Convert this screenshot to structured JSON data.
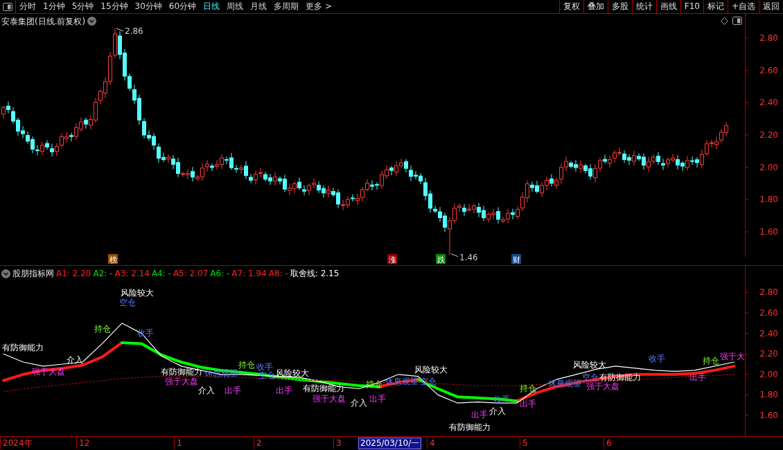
{
  "toolbar": {
    "tabs": [
      {
        "label": "分时",
        "selected": false
      },
      {
        "label": "1分钟",
        "selected": false
      },
      {
        "label": "5分钟",
        "selected": false
      },
      {
        "label": "15分钟",
        "selected": false
      },
      {
        "label": "30分钟",
        "selected": false
      },
      {
        "label": "60分钟",
        "selected": false
      },
      {
        "label": "日线",
        "selected": true
      },
      {
        "label": "周线",
        "selected": false
      },
      {
        "label": "月线",
        "selected": false
      },
      {
        "label": "多周期",
        "selected": false
      }
    ],
    "more": "更多 >",
    "buttons": [
      "复权",
      "叠加",
      "多股",
      "统计",
      "画线",
      "F10",
      "标记",
      "+自选",
      "返回"
    ]
  },
  "price_panel": {
    "title": "安泰集团(日线.前复权)",
    "high_label": "2.86",
    "low_label": "1.46",
    "markers": [
      {
        "text": "榜",
        "color": "#9c5200"
      },
      {
        "text": "涨",
        "color": "#9a0000"
      },
      {
        "text": "跌",
        "color": "#0a8a0a"
      },
      {
        "text": "财",
        "color": "#174a8c"
      }
    ],
    "axis_labels": [
      "2.80",
      "2.60",
      "2.40",
      "2.20",
      "2.00",
      "1.80",
      "1.60"
    ]
  },
  "indicator": {
    "title": "股朋指标网",
    "legend": [
      {
        "text": "A1: 2.20",
        "color": "#ff2020"
      },
      {
        "text": "A2: -",
        "color": "#00e000"
      },
      {
        "text": "A3: 2.14",
        "color": "#ff2020"
      },
      {
        "text": "A4: -",
        "color": "#00e000"
      },
      {
        "text": "A5: 2.07",
        "color": "#ff2020"
      },
      {
        "text": "A6: -",
        "color": "#00e000"
      },
      {
        "text": "A7: 1.94",
        "color": "#ff2020"
      },
      {
        "text": "A8: -",
        "color": "#ff2020"
      },
      {
        "text": "取舍线: 2.15",
        "color": "#ffffff"
      }
    ],
    "chart_data": {
      "type": "line",
      "ylim": [
        1.39,
        3.06
      ],
      "yticks": [
        {
          "value": 2.8,
          "label": "2.80"
        },
        {
          "value": 2.6,
          "label": "2.60"
        },
        {
          "value": 2.4,
          "label": "2.40"
        },
        {
          "value": 2.2,
          "label": "2.20"
        },
        {
          "value": 2.0,
          "label": "2.00"
        },
        {
          "value": 1.8,
          "label": "1.80"
        },
        {
          "value": 1.6,
          "label": "1.60"
        }
      ],
      "series": [
        {
          "color": "#ff1a1a",
          "values": [
            1.94,
            2.0,
            2.04,
            2.06,
            2.09,
            2.17,
            2.31,
            null,
            null,
            null,
            null,
            null,
            null,
            null,
            null,
            null,
            null,
            null,
            null,
            1.88,
            1.92,
            1.95,
            null,
            null,
            null,
            null,
            1.74,
            1.82,
            1.88,
            1.92,
            1.95,
            1.98,
            2.0,
            2.0,
            2.0,
            2.01,
            2.04,
            2.08
          ]
        },
        {
          "color": "#00ff00",
          "values": [
            null,
            null,
            null,
            null,
            null,
            null,
            2.31,
            2.3,
            2.19,
            2.12,
            2.07,
            2.04,
            2.02,
            2.0,
            1.97,
            1.95,
            1.93,
            1.91,
            1.89,
            1.88,
            null,
            1.95,
            1.86,
            1.78,
            1.77,
            1.76,
            1.74,
            null,
            null,
            null,
            null,
            null,
            null,
            null,
            null,
            null,
            null,
            null
          ]
        },
        {
          "color": "#ffffff",
          "values": [
            2.2,
            2.12,
            2.08,
            2.1,
            2.12,
            2.3,
            2.5,
            2.4,
            2.18,
            2.08,
            2.04,
            2.0,
            2.0,
            1.99,
            1.98,
            1.97,
            1.93,
            1.88,
            1.86,
            1.92,
            2.0,
            1.98,
            1.8,
            1.72,
            1.73,
            1.72,
            1.72,
            1.86,
            1.95,
            2.0,
            2.05,
            2.08,
            2.06,
            2.04,
            2.03,
            2.04,
            2.08,
            2.12
          ]
        },
        {
          "color": "#8a1010",
          "line_style": "dashed",
          "values": [
            1.83,
            1.86,
            1.88,
            1.9,
            1.92,
            1.94,
            1.96,
            1.97,
            1.98,
            1.98,
            1.98,
            1.97,
            1.97,
            1.96,
            1.96,
            1.95,
            1.94,
            1.94,
            1.93,
            1.92,
            1.92,
            1.92,
            1.91,
            1.9,
            1.89,
            1.89,
            1.89,
            1.9,
            1.91,
            1.92,
            1.93,
            1.94,
            1.95,
            1.96,
            1.97,
            1.98,
            1.99,
            2.0
          ]
        }
      ]
    },
    "signals": [
      {
        "text": "风险较大",
        "kind": "info"
      },
      {
        "text": "空仓",
        "kind": "rest"
      },
      {
        "text": "有防御能力",
        "kind": "info"
      },
      {
        "text": "持仓",
        "kind": "hold"
      },
      {
        "text": "收手",
        "kind": "rest"
      },
      {
        "text": "强于大盘",
        "kind": "strong"
      },
      {
        "text": "介入",
        "kind": "info"
      },
      {
        "text": "有防御能力",
        "kind": "info"
      },
      {
        "text": "强于大盘",
        "kind": "strong"
      },
      {
        "text": "介入",
        "kind": "info"
      },
      {
        "text": "出手",
        "kind": "strong"
      },
      {
        "text": "休息观望",
        "kind": "rest"
      },
      {
        "text": "持仓",
        "kind": "hold"
      },
      {
        "text": "收手",
        "kind": "rest"
      },
      {
        "text": "空仓",
        "kind": "rest"
      },
      {
        "text": "风险较大",
        "kind": "info"
      },
      {
        "text": "出手",
        "kind": "strong"
      },
      {
        "text": "有防御能力",
        "kind": "info"
      },
      {
        "text": "强于大盘",
        "kind": "strong"
      },
      {
        "text": "介入",
        "kind": "info"
      },
      {
        "text": "持仓",
        "kind": "hold"
      },
      {
        "text": "出手",
        "kind": "strong"
      },
      {
        "text": "休息观望",
        "kind": "rest"
      },
      {
        "text": "风险较大",
        "kind": "info"
      },
      {
        "text": "空仓",
        "kind": "rest"
      },
      {
        "text": "收手",
        "kind": "rest"
      },
      {
        "text": "出手",
        "kind": "strong"
      },
      {
        "text": "介入",
        "kind": "info"
      },
      {
        "text": "出手",
        "kind": "strong"
      },
      {
        "text": "有防御能力",
        "kind": "info"
      },
      {
        "text": "持仓",
        "kind": "hold"
      },
      {
        "text": "休息观望",
        "kind": "rest"
      },
      {
        "text": "风险较大",
        "kind": "info"
      },
      {
        "text": "空仓",
        "kind": "rest"
      },
      {
        "text": "有防御能力",
        "kind": "info"
      },
      {
        "text": "强于大盘",
        "kind": "strong"
      },
      {
        "text": "收手",
        "kind": "rest"
      },
      {
        "text": "出手",
        "kind": "strong"
      },
      {
        "text": "持仓",
        "kind": "hold"
      },
      {
        "text": "强于大",
        "kind": "strong"
      }
    ]
  },
  "time_axis": [
    {
      "text": "2024年",
      "kind": "month"
    },
    {
      "text": "12",
      "kind": "month"
    },
    {
      "text": "1",
      "kind": "month"
    },
    {
      "text": "2",
      "kind": "month"
    },
    {
      "text": "3",
      "kind": "month"
    },
    {
      "text": "2025/03/10/一",
      "kind": "cursor"
    },
    {
      "text": "4",
      "kind": "month"
    },
    {
      "text": "5",
      "kind": "month"
    },
    {
      "text": "6",
      "kind": "month"
    }
  ]
}
